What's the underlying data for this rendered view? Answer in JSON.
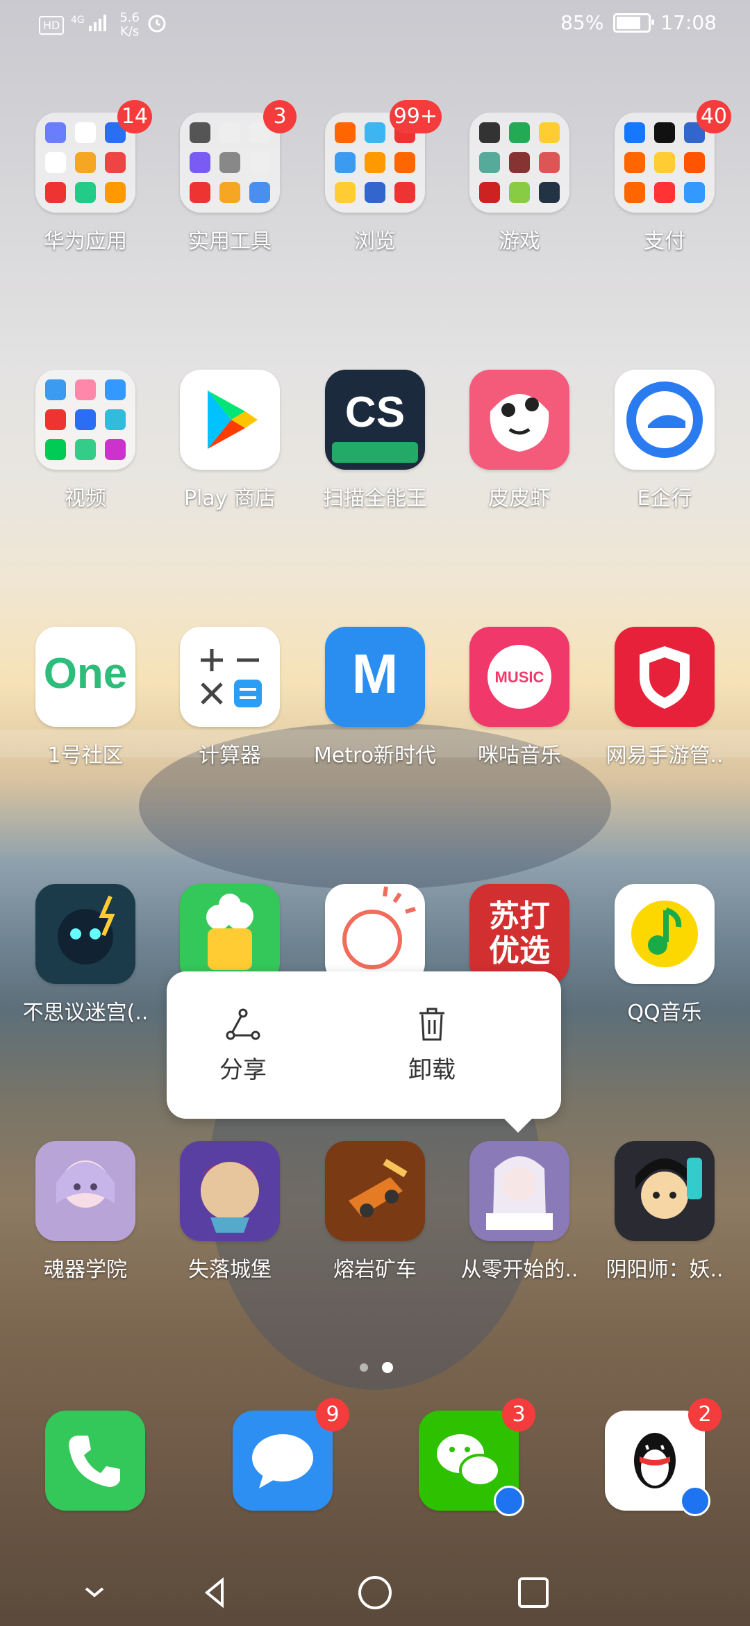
{
  "status_bar": {
    "hd": "HD",
    "net_type": "4G",
    "speed_value": "5.6",
    "speed_unit": "K/s",
    "battery": "85%",
    "time": "17:08"
  },
  "rows": [
    [
      {
        "label": "华为应用",
        "badge": "14",
        "icon": "huawei-apps-folder-icon"
      },
      {
        "label": "实用工具",
        "badge": "3",
        "icon": "tools-folder-icon"
      },
      {
        "label": "浏览",
        "badge": "99+",
        "icon": "browse-folder-icon"
      },
      {
        "label": "游戏",
        "badge": "",
        "icon": "games-folder-icon"
      },
      {
        "label": "支付",
        "badge": "40",
        "icon": "payment-folder-icon"
      }
    ],
    [
      {
        "label": "视频",
        "badge": "",
        "icon": "video-folder-icon"
      },
      {
        "label": "Play 商店",
        "badge": "",
        "icon": "play-store-icon"
      },
      {
        "label": "扫描全能王",
        "badge": "",
        "icon": "camscanner-icon",
        "text": "CS"
      },
      {
        "label": "皮皮虾",
        "badge": "",
        "icon": "pipixia-icon"
      },
      {
        "label": "E企行",
        "badge": "",
        "icon": "e-qixing-icon"
      }
    ],
    [
      {
        "label": "1号社区",
        "badge": "",
        "icon": "one-community-icon",
        "text": "One"
      },
      {
        "label": "计算器",
        "badge": "",
        "icon": "calculator-icon"
      },
      {
        "label": "Metro新时代",
        "badge": "",
        "icon": "metro-icon",
        "text": "M"
      },
      {
        "label": "咪咕音乐",
        "badge": "",
        "icon": "migu-music-icon",
        "text": "MUSIC"
      },
      {
        "label": "网易手游管..",
        "badge": "",
        "icon": "netease-games-icon"
      }
    ],
    [
      {
        "label": "不思议迷宫(..",
        "badge": "",
        "icon": "maze-game-icon"
      },
      {
        "label": "",
        "badge": "",
        "icon": "popcorn-game-icon"
      },
      {
        "label": "",
        "badge": "",
        "icon": "sun-app-icon"
      },
      {
        "label": "",
        "badge": "",
        "icon": "suda-youxuan-icon",
        "text": "苏打优选"
      },
      {
        "label": "QQ音乐",
        "badge": "",
        "icon": "qq-music-icon"
      }
    ],
    [
      {
        "label": "魂器学院",
        "badge": "",
        "icon": "hunqi-academy-icon"
      },
      {
        "label": "失落城堡",
        "badge": "",
        "icon": "lost-castle-icon"
      },
      {
        "label": "熔岩矿车",
        "badge": "",
        "icon": "lava-minecart-icon"
      },
      {
        "label": "从零开始的..",
        "badge": "",
        "icon": "rezero-game-icon"
      },
      {
        "label": "阴阳师：妖..",
        "badge": "",
        "icon": "onmyoji-icon"
      }
    ]
  ],
  "context_menu": {
    "share_label": "分享",
    "uninstall_label": "卸载"
  },
  "dock": [
    {
      "icon": "phone-icon",
      "badge": ""
    },
    {
      "icon": "messages-icon",
      "badge": "9"
    },
    {
      "icon": "wechat-icon",
      "badge": "3"
    },
    {
      "icon": "qq-icon",
      "badge": "2"
    }
  ],
  "colors": {
    "badge": "#f43c3c",
    "menu_bg": "#ffffff"
  }
}
